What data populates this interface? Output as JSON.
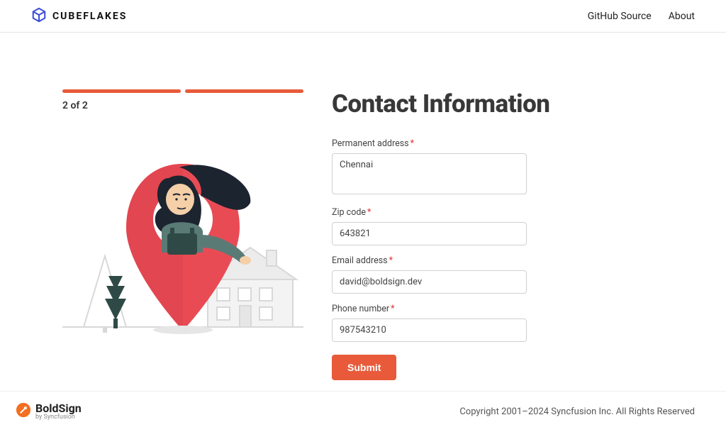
{
  "header": {
    "brand": "CUBEFLAKES",
    "nav": {
      "github": "GitHub Source",
      "about": "About"
    }
  },
  "progress": {
    "label": "2 of 2"
  },
  "form": {
    "title": "Contact Information",
    "address": {
      "label": "Permanent address",
      "value": "Chennai"
    },
    "zip": {
      "label": "Zip code",
      "value": "643821"
    },
    "email": {
      "label": "Email address",
      "value": "david@boldsign.dev"
    },
    "phone": {
      "label": "Phone number",
      "value": "987543210"
    },
    "submit": "Submit"
  },
  "footer": {
    "brand_main": "BoldSign",
    "brand_sub": "by Syncfusion",
    "copyright": "Copyright 2001–2024 Syncfusion Inc. All Rights Reserved"
  }
}
